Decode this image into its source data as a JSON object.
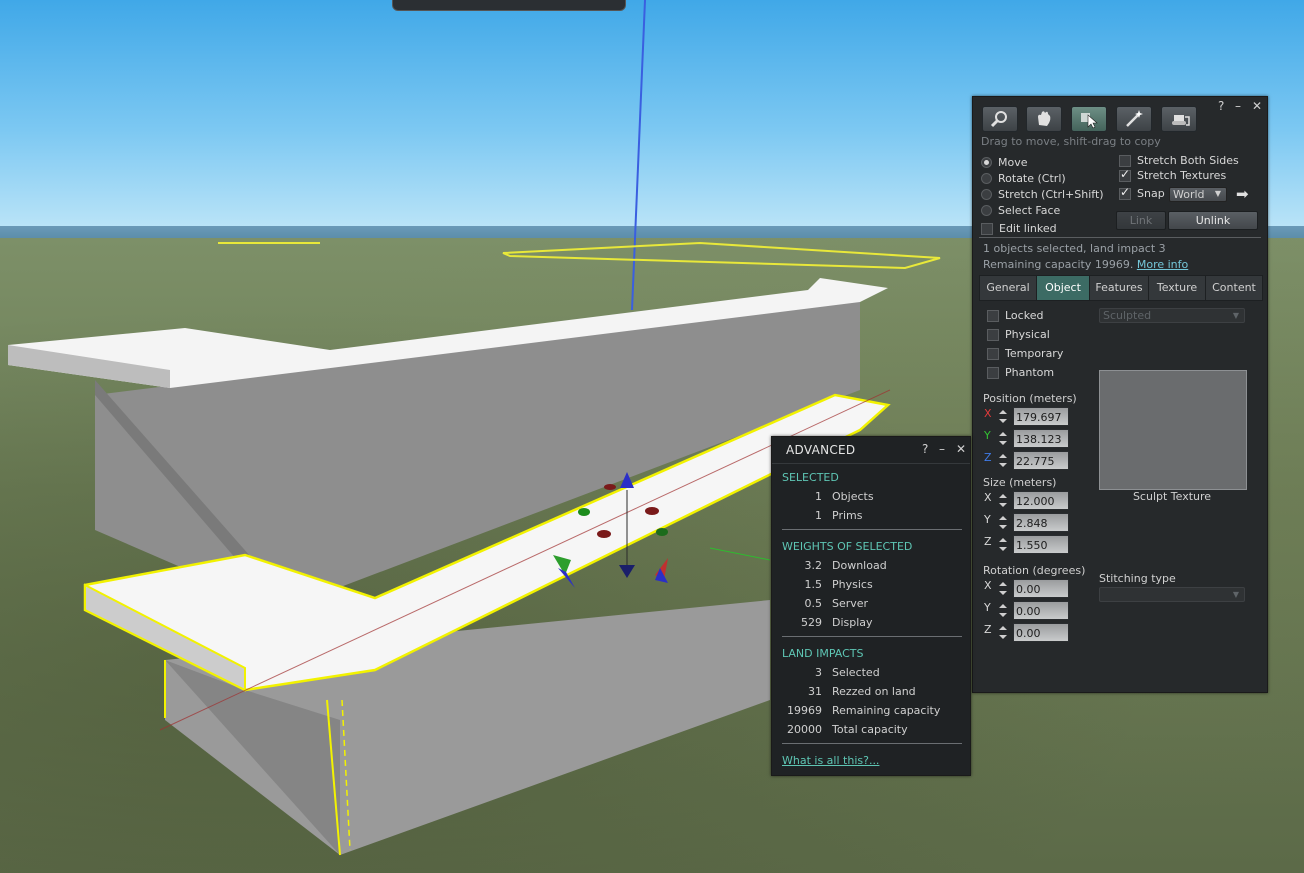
{
  "build_tools": {
    "title_controls": {
      "help": "?",
      "minimize": "–",
      "close": "✕"
    },
    "tools": [
      "focus",
      "move",
      "edit",
      "create",
      "land"
    ],
    "hint": "Drag to move, shift-drag to copy",
    "modes": [
      {
        "label": "Move",
        "selected": true
      },
      {
        "label": "Rotate (Ctrl)",
        "selected": false
      },
      {
        "label": "Stretch (Ctrl+Shift)",
        "selected": false
      },
      {
        "label": "Select Face",
        "selected": false
      }
    ],
    "edit_linked": {
      "label": "Edit linked",
      "checked": false
    },
    "stretch_both_sides": {
      "label": "Stretch Both Sides",
      "checked": false
    },
    "stretch_textures": {
      "label": "Stretch Textures",
      "checked": true
    },
    "snap": {
      "label": "Snap",
      "checked": true,
      "mode": "World"
    },
    "link_label": "Link",
    "unlink_label": "Unlink",
    "selection_info": "1 objects selected, land impact 3",
    "remaining_text": "Remaining capacity 19969.",
    "more_info": "More info",
    "tabs": [
      "General",
      "Object",
      "Features",
      "Texture",
      "Content"
    ],
    "active_tab": "Object",
    "checks": [
      {
        "label": "Locked",
        "checked": false
      },
      {
        "label": "Physical",
        "checked": false
      },
      {
        "label": "Temporary",
        "checked": false
      },
      {
        "label": "Phantom",
        "checked": false
      }
    ],
    "position": {
      "label": "Position (meters)",
      "x": "179.697",
      "y": "138.123",
      "z": "22.775"
    },
    "size": {
      "label": "Size (meters)",
      "x": "12.000",
      "y": "2.848",
      "z": "1.550"
    },
    "rotation": {
      "label": "Rotation (degrees)",
      "x": "0.00",
      "y": "0.00",
      "z": "0.00"
    },
    "axis_labels": {
      "x": "X",
      "y": "Y",
      "z": "Z"
    },
    "sculpt_type": "Sculpted",
    "sculpt_texture_label": "Sculpt Texture",
    "stitching_label": "Stitching type",
    "stitching_value": ""
  },
  "advanced": {
    "title": "ADVANCED",
    "controls": {
      "help": "?",
      "minimize": "–",
      "close": "✕"
    },
    "selected_head": "SELECTED",
    "selected": [
      {
        "value": "1",
        "label": "Objects"
      },
      {
        "value": "1",
        "label": "Prims"
      }
    ],
    "weights_head": "WEIGHTS OF SELECTED",
    "weights": [
      {
        "value": "3.2",
        "label": "Download"
      },
      {
        "value": "1.5",
        "label": "Physics"
      },
      {
        "value": "0.5",
        "label": "Server"
      },
      {
        "value": "529",
        "label": "Display"
      }
    ],
    "land_head": "LAND IMPACTS",
    "land": [
      {
        "value": "3",
        "label": "Selected"
      },
      {
        "value": "31",
        "label": "Rezzed on land"
      },
      {
        "value": "19969",
        "label": "Remaining capacity"
      },
      {
        "value": "20000",
        "label": "Total capacity"
      }
    ],
    "help_link": "What is all this?..."
  },
  "colors": {
    "accent_teal": "#5ec6b4",
    "tab_active": "#3c6b64",
    "link": "#74c6d8",
    "axis_x": "#e23b3b",
    "axis_y": "#33c233",
    "axis_z": "#3f7be8"
  }
}
